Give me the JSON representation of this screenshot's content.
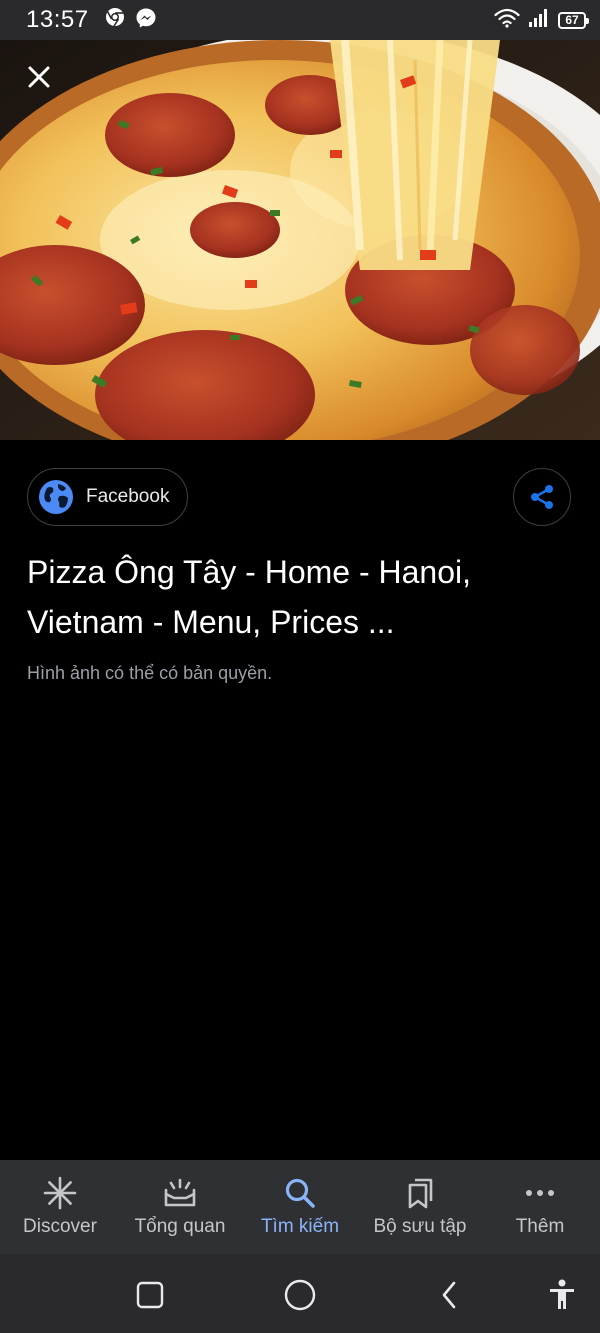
{
  "status_bar": {
    "time": "13:57",
    "battery": "67",
    "app_icons": [
      "chrome-icon",
      "messenger-icon"
    ],
    "right_icons": [
      "wifi-icon",
      "signal-icon",
      "battery-icon"
    ]
  },
  "viewer": {
    "close_icon": "close-icon",
    "image_subject": "pizza"
  },
  "source": {
    "label": "Facebook",
    "icon": "globe-icon"
  },
  "share_icon": "share-icon",
  "result": {
    "title": "Pizza Ông Tây - Home - Hanoi, Vietnam - Menu, Prices ...",
    "copyright_notice": "Hình ảnh có thể có bản quyền."
  },
  "bottom_nav": {
    "items": [
      {
        "label": "Discover",
        "icon": "asterisk-icon"
      },
      {
        "label": "Tổng quan",
        "icon": "overview-icon"
      },
      {
        "label": "Tìm kiếm",
        "icon": "search-icon"
      },
      {
        "label": "Bộ sưu tập",
        "icon": "collections-icon"
      },
      {
        "label": "Thêm",
        "icon": "more-icon"
      }
    ],
    "active_index": 2
  },
  "system_nav": [
    "recents-icon",
    "home-icon",
    "back-icon",
    "accessibility-icon"
  ],
  "colors": {
    "accent": "#8ab4f8",
    "globe": "#4c8bf5",
    "share": "#1a73e8",
    "nav_bg": "#2f3033",
    "status_bg": "#2a2a2c"
  }
}
